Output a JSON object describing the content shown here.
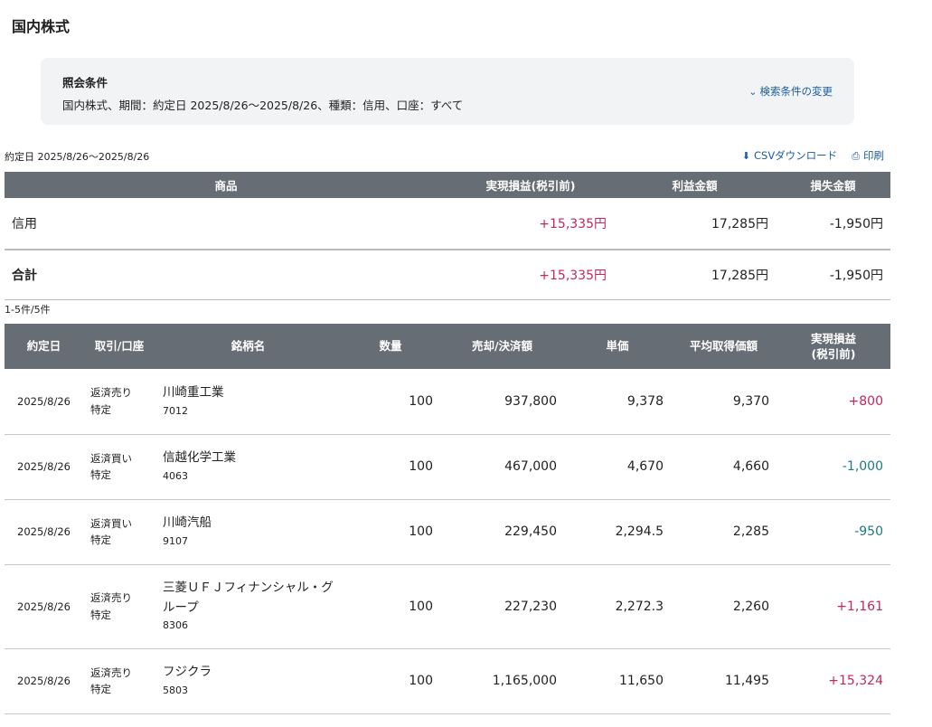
{
  "page": {
    "title": "国内株式"
  },
  "conditions": {
    "title": "照会条件",
    "text": "国内株式、期間：約定日 2025/8/26〜2025/8/26、種類：信用、口座：すべて",
    "change_link": "検索条件の変更"
  },
  "period_label": "約定日 2025/8/26〜2025/8/26",
  "actions": {
    "csv": "CSVダウンロード",
    "print": "印刷"
  },
  "summary": {
    "headers": {
      "product": "商品",
      "realized": "実現損益(税引前)",
      "profit": "利益金額",
      "loss": "損失金額"
    },
    "row": {
      "product": "信用",
      "realized": "+15,335円",
      "profit": "17,285円",
      "loss": "-1,950円"
    },
    "total": {
      "label": "合計",
      "realized": "+15,335円",
      "profit": "17,285円",
      "loss": "-1,950円"
    }
  },
  "count_label": "1-5件/5件",
  "detail": {
    "headers": {
      "date": "約定日",
      "trade": "取引/口座",
      "name": "銘柄名",
      "qty": "数量",
      "amount": "売却/決済額",
      "price": "単価",
      "avg": "平均取得価額",
      "pl_1": "実現損益",
      "pl_2": "(税引前)"
    },
    "rows": [
      {
        "date": "2025/8/26",
        "trade": "返済売り",
        "account": "特定",
        "name": "川崎重工業",
        "code": "7012",
        "qty": "100",
        "amount": "937,800",
        "price": "9,378",
        "avg": "9,370",
        "pl": "+800"
      },
      {
        "date": "2025/8/26",
        "trade": "返済買い",
        "account": "特定",
        "name": "信越化学工業",
        "code": "4063",
        "qty": "100",
        "amount": "467,000",
        "price": "4,670",
        "avg": "4,660",
        "pl": "-1,000"
      },
      {
        "date": "2025/8/26",
        "trade": "返済買い",
        "account": "特定",
        "name": "川崎汽船",
        "code": "9107",
        "qty": "100",
        "amount": "229,450",
        "price": "2,294.5",
        "avg": "2,285",
        "pl": "-950"
      },
      {
        "date": "2025/8/26",
        "trade": "返済売り",
        "account": "特定",
        "name": "三菱ＵＦＪフィナンシャル・グループ",
        "code": "8306",
        "qty": "100",
        "amount": "227,230",
        "price": "2,272.3",
        "avg": "2,260",
        "pl": "+1,161"
      },
      {
        "date": "2025/8/26",
        "trade": "返済売り",
        "account": "特定",
        "name": "フジクラ",
        "code": "5803",
        "qty": "100",
        "amount": "1,165,000",
        "price": "11,650",
        "avg": "11,495",
        "pl": "+15,324"
      }
    ]
  },
  "colors": {
    "header_bg": "#666d75",
    "positive": "#c4275a",
    "negative": "#1d7a80",
    "link": "#1c5ea0"
  }
}
